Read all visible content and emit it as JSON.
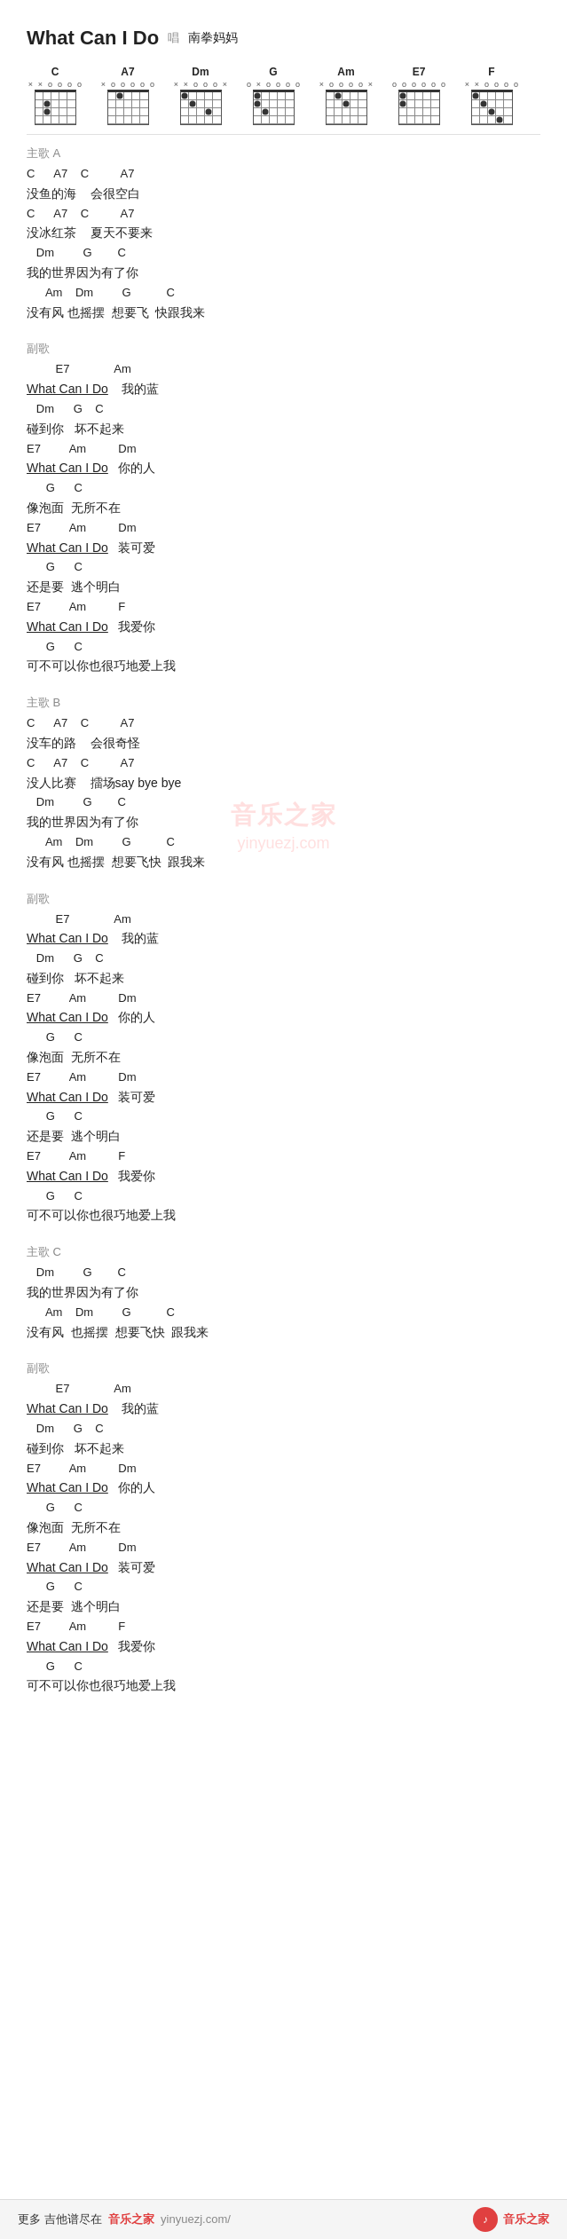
{
  "page": {
    "title": "What Can I Do",
    "singer_label": "唱",
    "singer_name": "南拳妈妈",
    "watermark1": "音乐之家",
    "watermark2": "yinyuezj.com",
    "footer_text": "更多 吉他谱尽在",
    "footer_brand": "音乐之家",
    "footer_url": "yinyuezj.com/",
    "footer_logo": "音乐之家"
  },
  "chords": [
    {
      "name": "C",
      "markers": [
        "x",
        "x",
        "o",
        "o",
        "o",
        "o"
      ],
      "dots": [
        [
          1,
          1
        ],
        [
          2,
          1
        ]
      ]
    },
    {
      "name": "A7",
      "markers": [
        "x",
        "o",
        "o",
        "o",
        "o",
        "o"
      ],
      "dots": [
        [
          0,
          1
        ]
      ]
    },
    {
      "name": "Dm",
      "markers": [
        "x",
        "x",
        "o",
        "o",
        "o",
        "x"
      ],
      "dots": [
        [
          0,
          0
        ],
        [
          1,
          1
        ],
        [
          2,
          3
        ]
      ]
    },
    {
      "name": "G",
      "markers": [
        "o",
        "x",
        "o",
        "o",
        "o",
        "o"
      ],
      "dots": [
        [
          0,
          0
        ],
        [
          1,
          0
        ],
        [
          2,
          1
        ]
      ]
    },
    {
      "name": "Am",
      "markers": [
        "x",
        "o",
        "o",
        "o",
        "o",
        "x"
      ],
      "dots": [
        [
          0,
          1
        ],
        [
          1,
          2
        ]
      ]
    },
    {
      "name": "E7",
      "markers": [
        "o",
        "o",
        "o",
        "o",
        "o",
        "o"
      ],
      "dots": [
        [
          0,
          0
        ],
        [
          1,
          0
        ]
      ]
    },
    {
      "name": "F",
      "markers": [
        "x",
        "x",
        "o",
        "o",
        "o",
        "o"
      ],
      "dots": [
        [
          0,
          0
        ],
        [
          1,
          1
        ],
        [
          2,
          2
        ],
        [
          3,
          3
        ]
      ]
    }
  ],
  "sections": [
    {
      "id": "verse_a",
      "label": "主歌 A",
      "lines": [
        {
          "type": "chord",
          "text": "C      A7    C          A7"
        },
        {
          "type": "lyric",
          "text": "没鱼的海    会很空白"
        },
        {
          "type": "chord",
          "text": "C      A7    C          A7"
        },
        {
          "type": "lyric",
          "text": "没冰红茶    夏天不要来"
        },
        {
          "type": "chord",
          "text": "   Dm         G        C"
        },
        {
          "type": "lyric",
          "text": "我的世界因为有了你"
        },
        {
          "type": "chord",
          "text": "      Am    Dm         G           C"
        },
        {
          "type": "lyric",
          "text": "没有风 也摇摆  想要飞  快跟我来"
        }
      ]
    },
    {
      "id": "chorus_1",
      "label": "副歌",
      "lines": [
        {
          "type": "chord",
          "text": "         E7              Am"
        },
        {
          "type": "lyric_mixed",
          "uline": "What Can I Do",
          "rest": "    我的蓝"
        },
        {
          "type": "chord",
          "text": "   Dm      G    C"
        },
        {
          "type": "lyric",
          "text": "碰到你   坏不起来"
        },
        {
          "type": "chord",
          "text": "E7         Am          Dm"
        },
        {
          "type": "lyric_mixed",
          "uline": "What Can I Do",
          "rest": "   你的人"
        },
        {
          "type": "chord",
          "text": "      G      C"
        },
        {
          "type": "lyric",
          "text": "像泡面  无所不在"
        },
        {
          "type": "chord",
          "text": "E7         Am          Dm"
        },
        {
          "type": "lyric_mixed",
          "uline": "What Can I Do",
          "rest": "   装可爱"
        },
        {
          "type": "chord",
          "text": "      G      C"
        },
        {
          "type": "lyric",
          "text": "还是要  逃个明白"
        },
        {
          "type": "chord",
          "text": "E7         Am          F"
        },
        {
          "type": "lyric_mixed",
          "uline": "What Can I Do",
          "rest": "   我爱你"
        },
        {
          "type": "chord",
          "text": "      G      C"
        },
        {
          "type": "lyric",
          "text": "可不可以你也很巧地爱上我"
        }
      ]
    },
    {
      "id": "verse_b",
      "label": "主歌 B",
      "lines": [
        {
          "type": "chord",
          "text": "C      A7    C          A7"
        },
        {
          "type": "lyric",
          "text": "没车的路    会很奇怪"
        },
        {
          "type": "chord",
          "text": "C      A7    C          A7"
        },
        {
          "type": "lyric",
          "text": "没人比赛    擂场say bye bye"
        },
        {
          "type": "chord",
          "text": "   Dm         G        C"
        },
        {
          "type": "lyric",
          "text": "我的世界因为有了你"
        },
        {
          "type": "chord",
          "text": "      Am    Dm         G           C"
        },
        {
          "type": "lyric",
          "text": "没有风 也摇摆  想要飞快  跟我来"
        }
      ]
    },
    {
      "id": "chorus_2",
      "label": "副歌",
      "lines": [
        {
          "type": "chord",
          "text": "         E7              Am"
        },
        {
          "type": "lyric_mixed",
          "uline": "What Can I Do",
          "rest": "    我的蓝"
        },
        {
          "type": "chord",
          "text": "   Dm      G    C"
        },
        {
          "type": "lyric",
          "text": "碰到你   坏不起来"
        },
        {
          "type": "chord",
          "text": "E7         Am          Dm"
        },
        {
          "type": "lyric_mixed",
          "uline": "What Can I Do",
          "rest": "   你的人"
        },
        {
          "type": "chord",
          "text": "      G      C"
        },
        {
          "type": "lyric",
          "text": "像泡面  无所不在"
        },
        {
          "type": "chord",
          "text": "E7         Am          Dm"
        },
        {
          "type": "lyric_mixed",
          "uline": "What Can I Do",
          "rest": "   装可爱"
        },
        {
          "type": "chord",
          "text": "      G      C"
        },
        {
          "type": "lyric",
          "text": "还是要  逃个明白"
        },
        {
          "type": "chord",
          "text": "E7         Am          F"
        },
        {
          "type": "lyric_mixed",
          "uline": "What Can I Do",
          "rest": "   我爱你"
        },
        {
          "type": "chord",
          "text": "      G      C"
        },
        {
          "type": "lyric",
          "text": "可不可以你也很巧地爱上我"
        }
      ]
    },
    {
      "id": "verse_c",
      "label": "主歌 C",
      "lines": [
        {
          "type": "chord",
          "text": "   Dm         G        C"
        },
        {
          "type": "lyric",
          "text": "我的世界因为有了你"
        },
        {
          "type": "chord",
          "text": "      Am    Dm         G           C"
        },
        {
          "type": "lyric",
          "text": "没有风  也摇摆  想要飞快  跟我来"
        }
      ]
    },
    {
      "id": "chorus_3",
      "label": "副歌",
      "lines": [
        {
          "type": "chord",
          "text": "         E7              Am"
        },
        {
          "type": "lyric_mixed",
          "uline": "What Can I Do",
          "rest": "    我的蓝"
        },
        {
          "type": "chord",
          "text": "   Dm      G    C"
        },
        {
          "type": "lyric",
          "text": "碰到你   坏不起来"
        },
        {
          "type": "chord",
          "text": "E7         Am          Dm"
        },
        {
          "type": "lyric_mixed",
          "uline": "What Can I Do",
          "rest": "   你的人"
        },
        {
          "type": "chord",
          "text": "      G      C"
        },
        {
          "type": "lyric",
          "text": "像泡面  无所不在"
        },
        {
          "type": "chord",
          "text": "E7         Am          Dm"
        },
        {
          "type": "lyric_mixed",
          "uline": "What Can I Do",
          "rest": "   装可爱"
        },
        {
          "type": "chord",
          "text": "      G      C"
        },
        {
          "type": "lyric",
          "text": "还是要  逃个明白"
        },
        {
          "type": "chord",
          "text": "E7         Am          F"
        },
        {
          "type": "lyric_mixed",
          "uline": "What Can I Do",
          "rest": "   我爱你"
        },
        {
          "type": "chord",
          "text": "      G      C"
        },
        {
          "type": "lyric",
          "text": "可不可以你也很巧地爱上我"
        }
      ]
    }
  ],
  "footer": {
    "left": "更多 吉他谱尽在",
    "brand": "音乐之家",
    "url": "yinyuezj.com/",
    "logo_text": "音乐之家"
  }
}
